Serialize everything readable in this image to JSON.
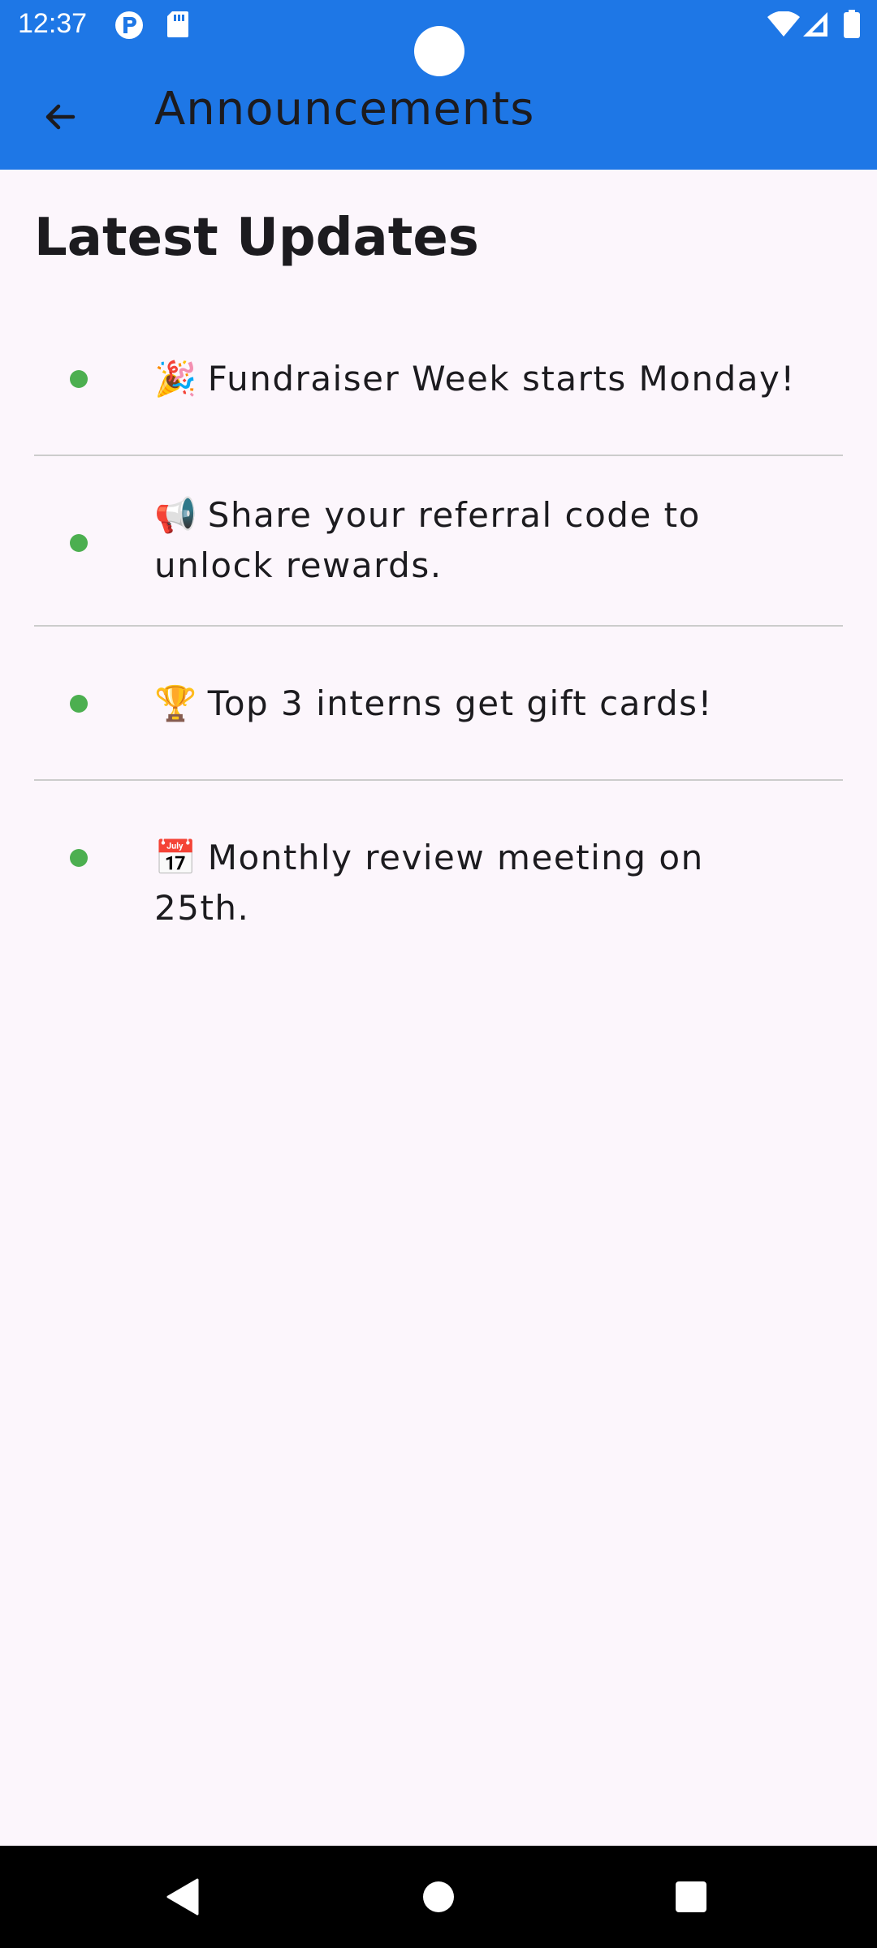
{
  "status_bar": {
    "time": "12:37",
    "icons": [
      "notification-p-icon",
      "sd-card-icon",
      "wifi-icon",
      "signal-icon",
      "battery-icon"
    ]
  },
  "app_bar": {
    "title": "Announcements",
    "back_icon": "arrow-back-icon",
    "background_color": "#1e77e6"
  },
  "content": {
    "section_title": "Latest Updates",
    "announcements": [
      {
        "emoji": "🎉",
        "text": "Fundraiser Week starts Monday!"
      },
      {
        "emoji": "📢",
        "text": "Share your referral code to unlock rewards."
      },
      {
        "emoji": "🏆",
        "text": "Top 3 interns get gift cards!"
      },
      {
        "emoji": "📅",
        "text": "Monthly review meeting on 25th."
      }
    ],
    "bullet_color": "#4caf50"
  },
  "nav_bar": {
    "icons": [
      "back-triangle-icon",
      "home-circle-icon",
      "recents-square-icon"
    ]
  }
}
